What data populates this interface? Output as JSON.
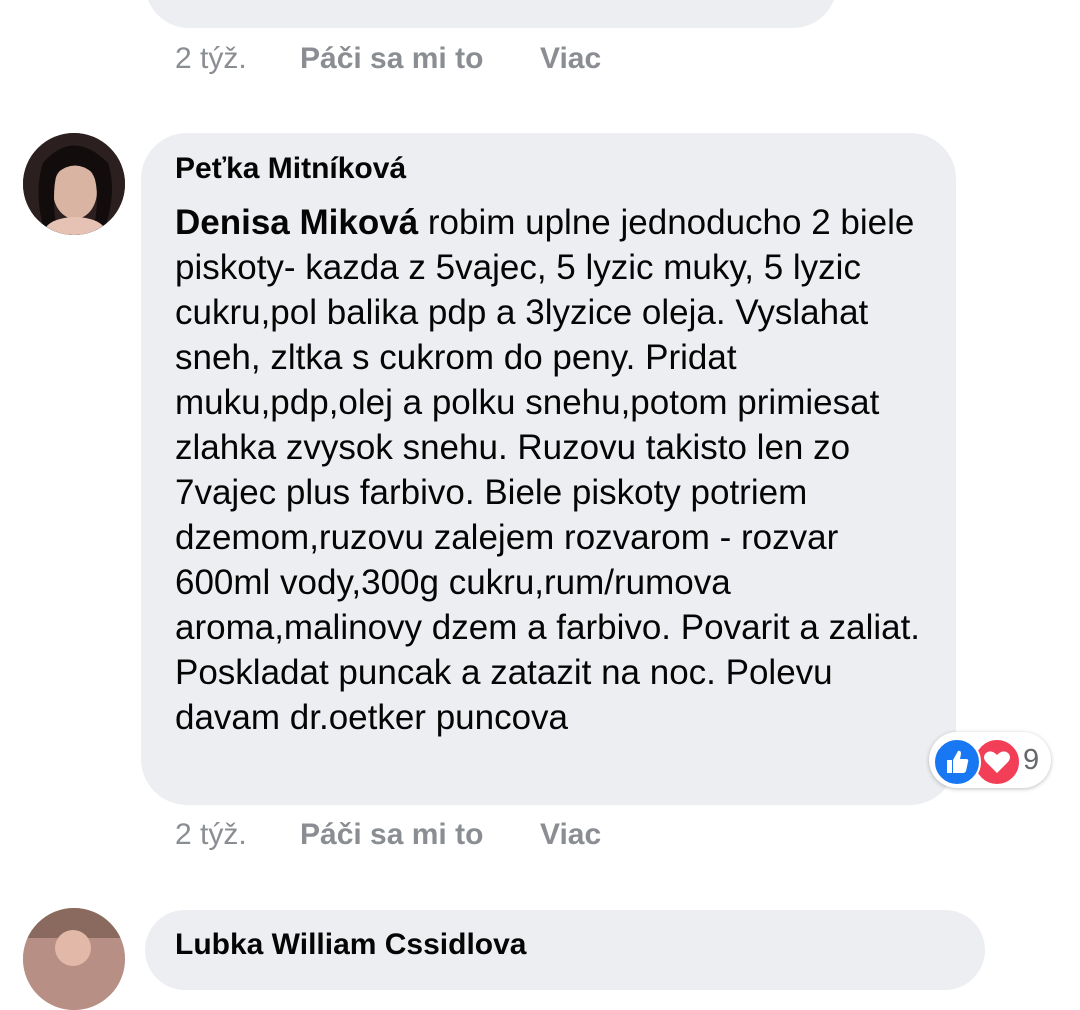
{
  "previous_comment": {
    "time": "2 týž.",
    "like_label": "Páči sa mi to",
    "more_label": "Viac"
  },
  "comment": {
    "author": "Peťka Mitníková",
    "mention": "Denisa Miková",
    "text": " robim uplne jednoducho 2 biele piskoty- kazda z 5vajec, 5 lyzic muky, 5 lyzic cukru,pol balika pdp a 3lyzice oleja. Vyslahat sneh, zltka s cukrom do peny. Pridat muku,pdp,olej a polku snehu,potom primiesat zlahka zvysok snehu. Ruzovu takisto len zo 7vajec plus farbivo. Biele piskoty potriem dzemom,ruzovu zalejem rozvarom - rozvar 600ml vody,300g cukru,rum/rumova aroma,malinovy dzem a farbivo. Povarit a zaliat. Poskladat puncak a zatazit na noc. Polevu davam dr.oetker puncova",
    "reaction_icons": [
      "like-icon",
      "love-icon"
    ],
    "reaction_count": "9",
    "time": "2 týž.",
    "like_label": "Páči sa mi to",
    "more_label": "Viac"
  },
  "next_comment": {
    "author": "Lubka William Cssidlova"
  },
  "colors": {
    "bubble": "#eceef1",
    "meta_text": "#8a8d91",
    "like_blue": "#1877f2",
    "love_red": "#f33e58"
  }
}
